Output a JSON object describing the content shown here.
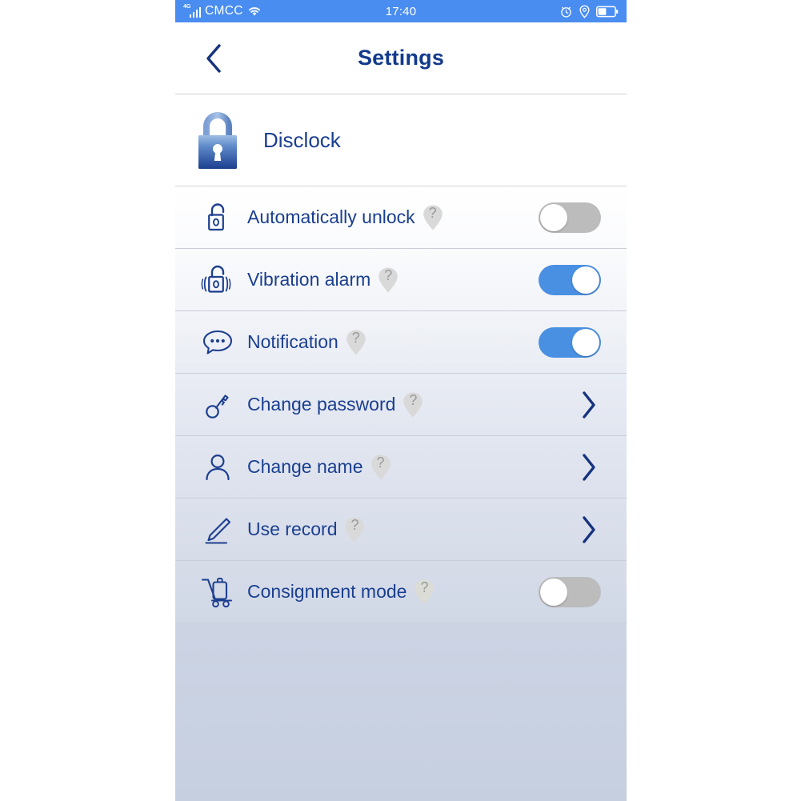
{
  "status_bar": {
    "network_type": "4G",
    "carrier": "CMCC",
    "wifi_icon": "wifi-icon",
    "signal_icon": "signal-bars-icon",
    "time": "17:40",
    "alarm_icon": "alarm-clock-icon",
    "location_icon": "location-pin-icon",
    "battery_icon": "battery-icon",
    "battery_level_percent": 45,
    "background_color": "#4a8df0"
  },
  "nav": {
    "back_icon": "chevron-left-icon",
    "title": "Settings",
    "title_color": "#123a8c"
  },
  "device": {
    "icon": "padlock-icon",
    "name": "Disclock"
  },
  "colors": {
    "accent_blue": "#4a90e2",
    "label_blue": "#1a3f8f",
    "toggle_off_gray": "#bcbcbc",
    "help_badge_gray": "#d8d8d8"
  },
  "settings_rows": [
    {
      "label": "Automatically unlock",
      "icon": "open-padlock-icon",
      "help_icon": "question-mark-badge",
      "help_char": "?",
      "control": "toggle",
      "toggle_state": "off"
    },
    {
      "label": "Vibration alarm",
      "icon": "vibrating-padlock-icon",
      "help_icon": "question-mark-badge",
      "help_char": "?",
      "control": "toggle",
      "toggle_state": "on"
    },
    {
      "label": "Notification",
      "icon": "speech-bubble-icon",
      "help_icon": "question-mark-badge",
      "help_char": "?",
      "control": "toggle",
      "toggle_state": "on"
    },
    {
      "label": "Change password",
      "icon": "key-icon",
      "help_icon": "question-mark-badge",
      "help_char": "?",
      "control": "chevron",
      "chevron_icon": "chevron-right-icon"
    },
    {
      "label": "Change name",
      "icon": "person-icon",
      "help_icon": "question-mark-badge",
      "help_char": "?",
      "control": "chevron",
      "chevron_icon": "chevron-right-icon"
    },
    {
      "label": "Use record",
      "icon": "pencil-edit-icon",
      "help_icon": "question-mark-badge",
      "help_char": "?",
      "control": "chevron",
      "chevron_icon": "chevron-right-icon"
    },
    {
      "label": "Consignment mode",
      "icon": "luggage-cart-icon",
      "help_icon": "question-mark-badge",
      "help_char": "?",
      "control": "toggle",
      "toggle_state": "off"
    }
  ]
}
